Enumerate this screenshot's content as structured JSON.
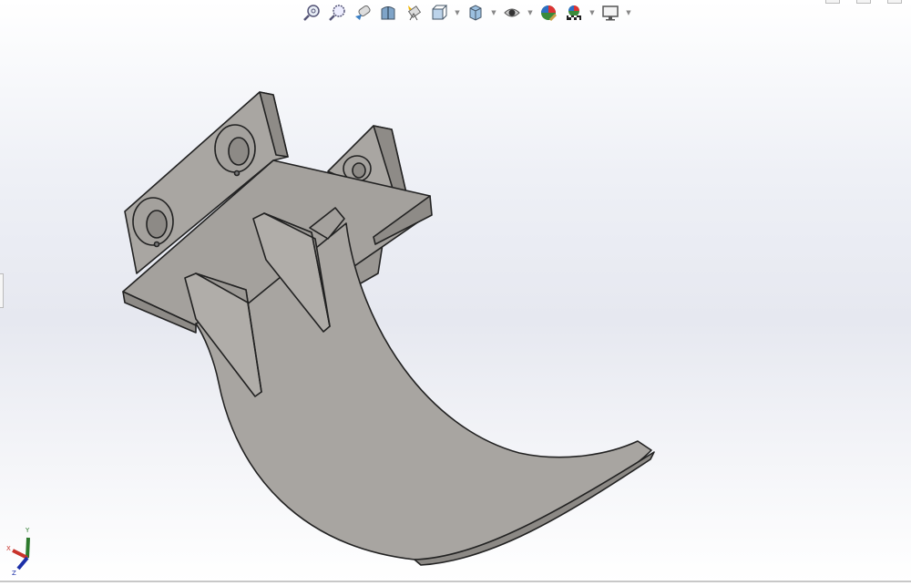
{
  "toolbar": {
    "items": [
      {
        "icon": "zoom-to-fit-icon"
      },
      {
        "icon": "zoom-to-area-icon"
      },
      {
        "icon": "previous-view-icon"
      },
      {
        "icon": "section-view-icon"
      },
      {
        "icon": "dynamic-annotation-views-icon"
      },
      {
        "icon": "view-orientation-icon",
        "dropdown": true
      },
      {
        "icon": "display-style-icon",
        "dropdown": true
      },
      {
        "icon": "hide-show-items-icon",
        "dropdown": true
      },
      {
        "icon": "edit-appearance-icon"
      },
      {
        "icon": "apply-scene-icon",
        "dropdown": true
      },
      {
        "icon": "view-settings-icon",
        "dropdown": true
      }
    ]
  },
  "triad": {
    "x_label": "X",
    "y_label": "Y",
    "z_label": "Z"
  },
  "colors": {
    "part": "#a8a5a1",
    "part_dark": "#8f8c88",
    "edge": "#2a2a2a",
    "accent": "#1f6fc0"
  }
}
